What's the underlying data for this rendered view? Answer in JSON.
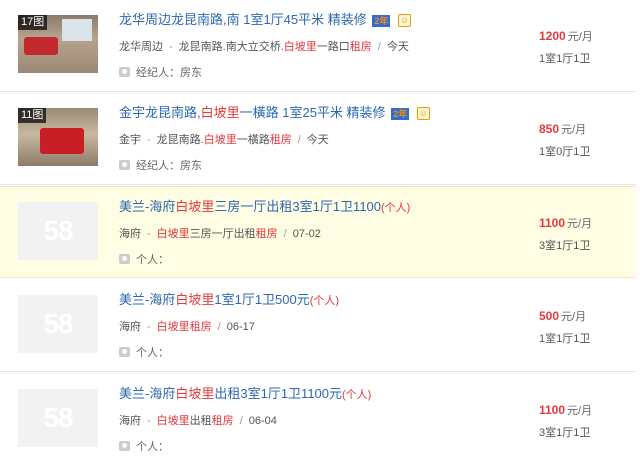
{
  "listings": [
    {
      "photo_count": "17图",
      "title": "龙华周边龙昆南路,南 1室1厅45平米 精装修",
      "badge_years": "2年",
      "badge_face": "☺",
      "area": "龙华周边",
      "road": "龙昆南路.南大立交桥.",
      "road_red": "白坡里",
      "road_suffix": "一路口",
      "rent_tag": "租房",
      "date": "今天",
      "agent_label": "经纪人：",
      "agent_name": "房东",
      "price": "1200",
      "price_unit": "元/月",
      "layout": "1室1厅1卫"
    },
    {
      "photo_count": "11图",
      "title_pre": "金宇龙昆南路,",
      "title_red": "白坡里",
      "title_post": "一橫路 1室25平米 精装修",
      "badge_years": "2年",
      "badge_face": "☺",
      "area": "金宇",
      "road": "龙昆南路.",
      "road_red": "白坡里",
      "road_suffix": "一橫路",
      "rent_tag": "租房",
      "date": "今天",
      "agent_label": "经纪人：",
      "agent_name": "房东",
      "price": "850",
      "price_unit": "元/月",
      "layout": "1室0厅1卫"
    },
    {
      "placeholder": "58",
      "title_pre": "美兰-海府",
      "title_red": "白坡里",
      "title_post": "三房一厅出租3室1厅1卫1100",
      "title_tag": "(个人)",
      "area": "海府",
      "road_red": "白坡里",
      "road_suffix": "三房一厅出租",
      "rent_tag": "租房",
      "date": "07-02",
      "agent_label": "个人：",
      "price": "1100",
      "price_unit": "元/月",
      "layout": "3室1厅1卫"
    },
    {
      "placeholder": "58",
      "title_pre": "美兰-海府",
      "title_red": "白坡里",
      "title_post": "1室1厅1卫500元",
      "title_tag": "(个人)",
      "area": "海府",
      "road_red": "白坡里",
      "road_suffix": "",
      "rent_tag": "租房",
      "date": "06-17",
      "agent_label": "个人：",
      "price": "500",
      "price_unit": "元/月",
      "layout": "1室1厅1卫"
    },
    {
      "placeholder": "58",
      "title_pre": "美兰-海府",
      "title_red": "白坡里",
      "title_post": "出租3室1厅1卫1100元",
      "title_tag": "(个人)",
      "area": "海府",
      "road_red": "白坡里",
      "road_suffix": "出租",
      "rent_tag": "租房",
      "date": "06-04",
      "agent_label": "个人：",
      "price": "1100",
      "price_unit": "元/月",
      "layout": "3室1厅1卫"
    }
  ],
  "colors": {
    "link_blue": "#2e67b1",
    "highlight_red": "#e4393c",
    "highlight_row_bg": "#fffde3"
  }
}
